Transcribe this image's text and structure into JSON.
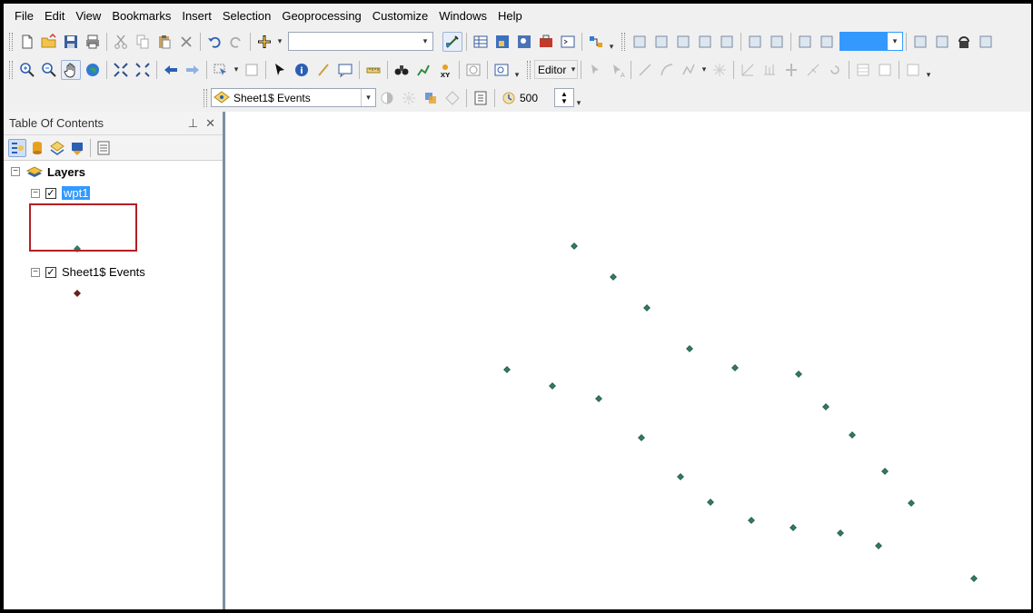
{
  "menubar": [
    "File",
    "Edit",
    "View",
    "Bookmarks",
    "Insert",
    "Selection",
    "Geoprocessing",
    "Customize",
    "Windows",
    "Help"
  ],
  "toolbar3": {
    "layer_select": "Sheet1$ Events",
    "number_value": "500"
  },
  "editor_menu": "Editor",
  "toc": {
    "title": "Table Of Contents",
    "pin_icon": "pin-icon",
    "close_icon": "close-icon",
    "root": "Layers",
    "layers": [
      {
        "name": "wpt1",
        "checked": true,
        "selected": true,
        "symbol_color": "#2e7d5b"
      },
      {
        "name": "Sheet1$ Events",
        "checked": true,
        "selected": false,
        "symbol_color": "#6b1f1f"
      }
    ]
  },
  "colors": {
    "point_symbol": "#2e7d5b",
    "highlight_box": "#b21f24",
    "selection": "#3399ff"
  }
}
